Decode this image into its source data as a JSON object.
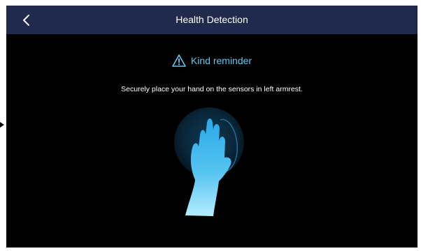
{
  "header": {
    "title": "Health Detection"
  },
  "reminder": {
    "label": "Kind reminder",
    "icon": "warning-triangle-icon"
  },
  "instruction": "Securely place your hand on the sensors in left armrest.",
  "illustration": {
    "icon": "hand-on-sensor-icon"
  },
  "colors": {
    "header_bg": "#1f2a4d",
    "accent": "#5ec8f2",
    "background": "#000000"
  }
}
